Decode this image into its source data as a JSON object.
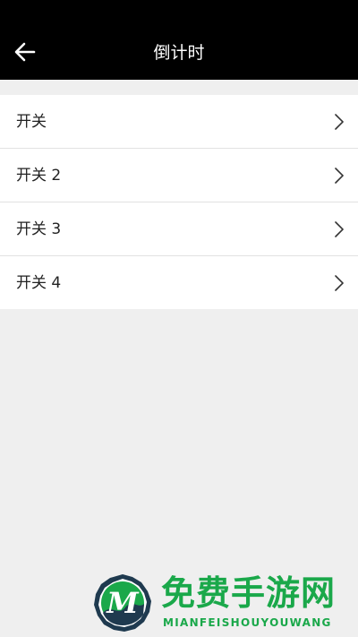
{
  "header": {
    "title": "倒计时",
    "back_icon": "arrow-left-icon"
  },
  "list": {
    "items": [
      {
        "label": "开关",
        "icon": "chevron-right-icon"
      },
      {
        "label": "开关 2",
        "icon": "chevron-right-icon"
      },
      {
        "label": "开关 3",
        "icon": "chevron-right-icon"
      },
      {
        "label": "开关 4",
        "icon": "chevron-right-icon"
      }
    ]
  },
  "watermark": {
    "title": "免费手游网",
    "subtitle": "MIANFEISHOUYOUWANG",
    "colors": {
      "green": "#1aa84a",
      "dark": "#1f3a4f"
    }
  },
  "colors": {
    "app_bar": "#000000",
    "background": "#efefef",
    "list_background": "#ffffff"
  }
}
